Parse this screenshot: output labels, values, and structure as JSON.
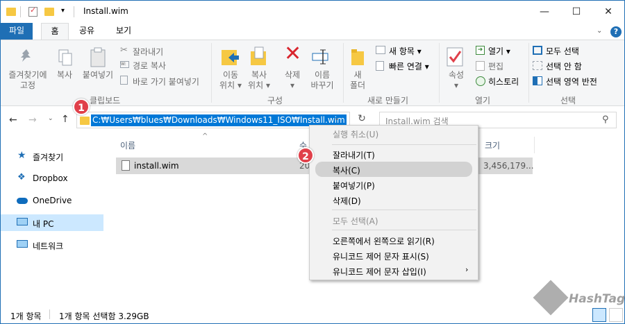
{
  "window": {
    "title": "Install.wim",
    "controls": {
      "minimize": "—",
      "maximize": "☐",
      "close": "✕"
    }
  },
  "tabs": {
    "file": "파일",
    "home": "홈",
    "share": "공유",
    "view": "보기"
  },
  "ribbon": {
    "clipboard": {
      "pin_label_1": "즐겨찾기에",
      "pin_label_2": "고정",
      "copy_label": "복사",
      "paste_label": "붙여넣기",
      "cut_label": "잘라내기",
      "copy_path_label": "경로 복사",
      "paste_shortcut_label": "바로 가기 붙여넣기",
      "group_title": "클립보드"
    },
    "organize": {
      "move_label_1": "이동",
      "move_label_2": "위치",
      "copyto_label_1": "복사",
      "copyto_label_2": "위치",
      "delete_label": "삭제",
      "rename_label_1": "이름",
      "rename_label_2": "바꾸기",
      "group_title": "구성"
    },
    "new": {
      "new_folder_label_1": "새",
      "new_folder_label_2": "폴더",
      "new_item_label": "새 항목",
      "easy_access_label": "빠른 연결",
      "group_title": "새로 만들기"
    },
    "open": {
      "properties_label": "속성",
      "open_label": "열기",
      "edit_label": "편집",
      "history_label": "히스토리",
      "group_title": "열기"
    },
    "select": {
      "select_all_label": "모두 선택",
      "select_none_label": "선택 안 함",
      "invert_label": "선택 영역 반전",
      "group_title": "선택"
    }
  },
  "address": {
    "path": "C:₩Users₩blues₩Downloads₩Windows11_ISO₩Install.wim",
    "search_placeholder": "Install.wim 검색"
  },
  "nav": [
    {
      "label": "즐겨찾기",
      "icon": "star-icon"
    },
    {
      "label": "Dropbox",
      "icon": "dropbox-icon"
    },
    {
      "label": "OneDrive",
      "icon": "cloud-icon"
    },
    {
      "label": "내 PC",
      "icon": "computer-icon"
    },
    {
      "label": "네트워크",
      "icon": "network-icon"
    }
  ],
  "columns": {
    "name": "이름",
    "date_fragment": "수",
    "size": "크기"
  },
  "files": [
    {
      "name": "install.wim",
      "date_fragment": "20",
      "size": "3,456,179..."
    }
  ],
  "context_menu": {
    "undo": "실행 취소(U)",
    "cut": "잘라내기(T)",
    "copy": "복사(C)",
    "paste": "붙여넣기(P)",
    "delete": "삭제(D)",
    "select_all": "모두 선택(A)",
    "rtl": "오른쪽에서 왼쪽으로 읽기(R)",
    "show_unicode": "유니코드 제어 문자 표시(S)",
    "insert_unicode": "유니코드 제어 문자 삽입(I)"
  },
  "badges": {
    "one": "1",
    "two": "2"
  },
  "status": {
    "count": "1개 항목",
    "selected": "1개 항목 선택함 3.29GB"
  },
  "watermark": {
    "text": "HashTag"
  },
  "colors": {
    "accent": "#1f6fb5",
    "selection": "#0078d7",
    "badge": "#e0404a",
    "nav_selected": "#cce8ff"
  }
}
